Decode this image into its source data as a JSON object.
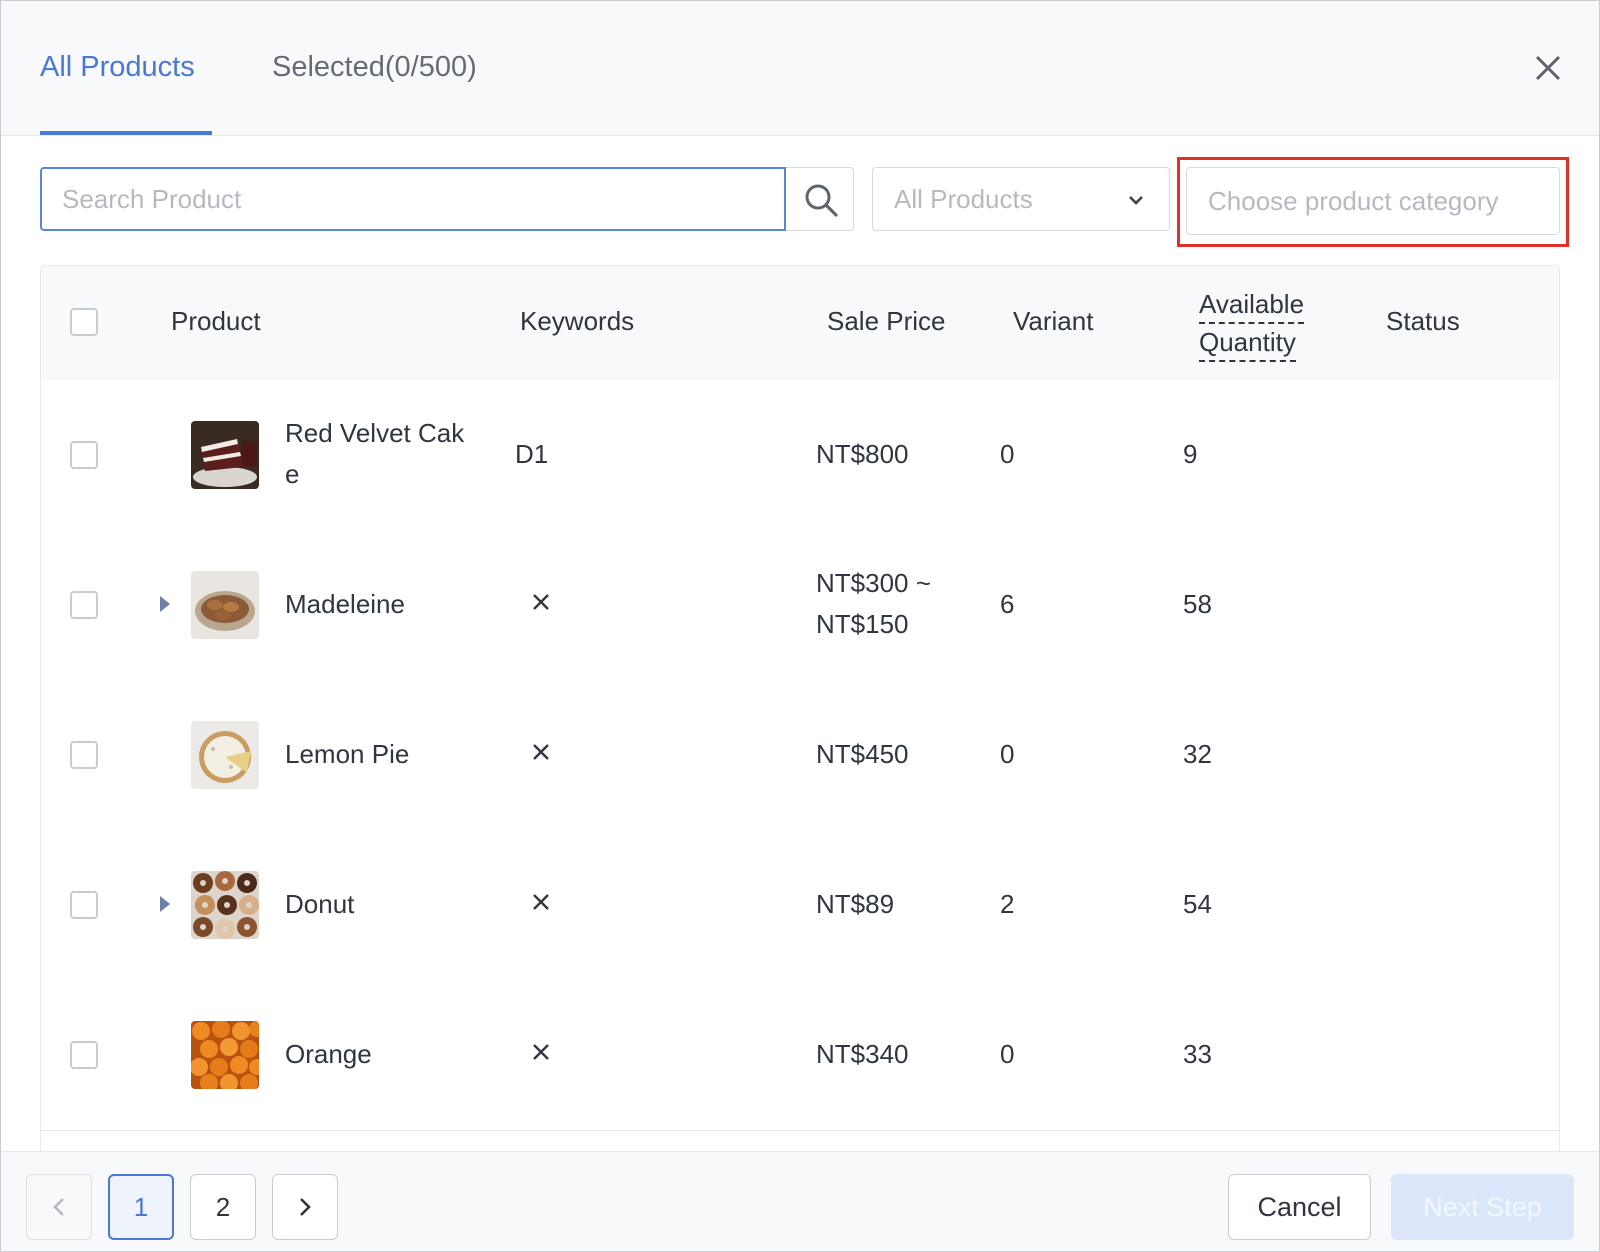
{
  "tabs": {
    "all_products": "All Products",
    "selected": "Selected(0/500)"
  },
  "toolbar": {
    "search_placeholder": "Search Product",
    "filter_value": "All Products",
    "category_placeholder": "Choose product category"
  },
  "table": {
    "headers": {
      "product": "Product",
      "keywords": "Keywords",
      "sale_price": "Sale Price",
      "variant": "Variant",
      "available_line1": "Available",
      "available_line2": "Quantity",
      "status": "Status"
    },
    "rows": [
      {
        "name_line1": "Red Velvet Cak",
        "name_line2": "e",
        "keywords": "D1",
        "price_line1": "NT$800",
        "price_line2": "",
        "variant": "0",
        "quantity": "9",
        "status": "",
        "expandable": false,
        "image": "cake"
      },
      {
        "name_line1": "Madeleine",
        "name_line2": "",
        "keywords": "",
        "price_line1": "NT$300 ~",
        "price_line2": "NT$150",
        "variant": "6",
        "quantity": "58",
        "status": "",
        "expandable": true,
        "image": "madeleine"
      },
      {
        "name_line1": "Lemon Pie",
        "name_line2": "",
        "keywords": "",
        "price_line1": "NT$450",
        "price_line2": "",
        "variant": "0",
        "quantity": "32",
        "status": "",
        "expandable": false,
        "image": "pie"
      },
      {
        "name_line1": "Donut",
        "name_line2": "",
        "keywords": "",
        "price_line1": "NT$89",
        "price_line2": "",
        "variant": "2",
        "quantity": "54",
        "status": "",
        "expandable": true,
        "image": "donut"
      },
      {
        "name_line1": "Orange",
        "name_line2": "",
        "keywords": "",
        "price_line1": "NT$340",
        "price_line2": "",
        "variant": "0",
        "quantity": "33",
        "status": "",
        "expandable": false,
        "image": "orange"
      }
    ]
  },
  "pagination": {
    "pages": [
      "1",
      "2"
    ],
    "current": "1"
  },
  "footer": {
    "cancel_label": "Cancel",
    "next_label": "Next Step"
  },
  "colors": {
    "accent": "#4a78d6",
    "highlight": "#e0302a"
  },
  "icons": {
    "close": "close-icon",
    "search": "search-icon",
    "dropdown": "chevron-down-icon",
    "expand": "caret-right-icon",
    "no_keyword": "x-mark-icon",
    "prev": "chevron-left-icon",
    "next": "chevron-right-icon"
  }
}
